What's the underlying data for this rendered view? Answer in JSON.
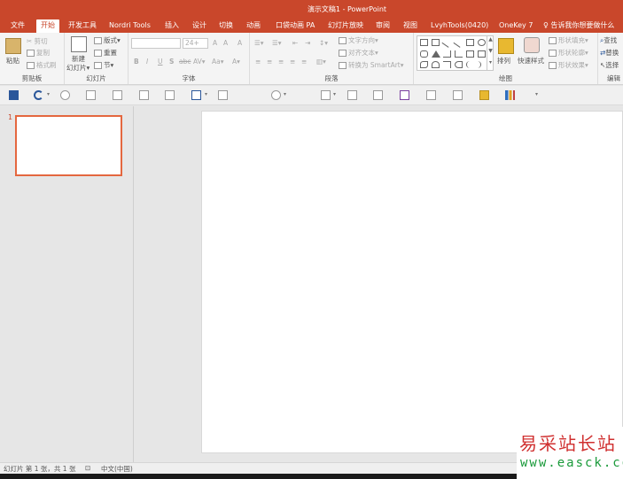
{
  "window": {
    "title": "演示文稿1 - PowerPoint"
  },
  "tabs": [
    {
      "label": "文件"
    },
    {
      "label": "开始"
    },
    {
      "label": "开发工具"
    },
    {
      "label": "Nordri Tools"
    },
    {
      "label": "插入"
    },
    {
      "label": "设计"
    },
    {
      "label": "切换"
    },
    {
      "label": "动画"
    },
    {
      "label": "口袋动画 PA"
    },
    {
      "label": "幻灯片放映"
    },
    {
      "label": "审阅"
    },
    {
      "label": "视图"
    },
    {
      "label": "LvyhTools(0420)"
    },
    {
      "label": "OneKey 7"
    }
  ],
  "tell_me": "♀ 告诉我你想要做什么",
  "ribbon": {
    "clipboard": {
      "label": "剪贴板",
      "paste": "粘贴",
      "cut": "✂ 剪切",
      "copy": "复制",
      "format_painter": "格式刷"
    },
    "slides": {
      "label": "幻灯片",
      "new_slide_1": "新建",
      "new_slide_2": "幻灯片▾",
      "layout": "版式▾",
      "reset": "重置",
      "section": "节▾"
    },
    "font": {
      "label": "字体",
      "font_size": "24+",
      "bold": "B",
      "italic": "I",
      "underline": "U",
      "shadow": "S",
      "strike": "abc",
      "spacing": "AV▾",
      "case": "Aa▾",
      "grow": "A",
      "shrink": "A",
      "clear": "A"
    },
    "paragraph": {
      "label": "段落",
      "text_direction": "文字方向▾",
      "align_text": "对齐文本▾",
      "smartart": "转换为 SmartArt▾"
    },
    "drawing": {
      "label": "绘图",
      "arrange": "排列",
      "quick_styles": "快速样式",
      "shape_fill": "形状填充▾",
      "shape_outline": "形状轮廓▾",
      "shape_effects": "形状效果▾"
    },
    "editing": {
      "label": "编辑",
      "find": "查找",
      "replace": "替换",
      "select": "选择"
    }
  },
  "slides_pane": {
    "slide_number": "1"
  },
  "statusbar": {
    "slide_info": "幻灯片 第 1 张，共 1 张",
    "language": "中文(中国)"
  },
  "watermark": {
    "text_cn": "易采站长站",
    "url": "www.easck.com"
  }
}
